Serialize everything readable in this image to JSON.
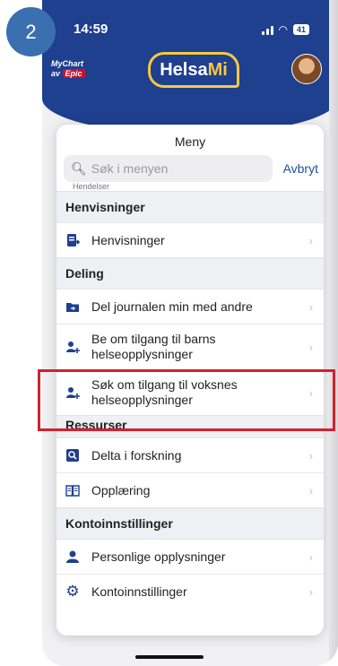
{
  "step_badge": "2",
  "status_bar": {
    "time": "14:59",
    "battery": "41"
  },
  "header": {
    "mychart_line1": "MyChart",
    "mychart_by": "av",
    "mychart_epic": "Epic",
    "brand_part1": "Helsa",
    "brand_part2": "Mi"
  },
  "menu": {
    "title": "Meny",
    "search_placeholder": "Søk i menyen",
    "cancel_label": "Avbryt",
    "peek_label": "Hendelser",
    "sections": [
      {
        "title": "Henvisninger",
        "items": [
          {
            "label": "Henvisninger",
            "icon": "referral-icon"
          }
        ]
      },
      {
        "title": "Deling",
        "items": [
          {
            "label": "Del journalen min med andre",
            "icon": "share-folder-icon"
          },
          {
            "label": "Be om tilgang til barns helseopplysninger",
            "icon": "add-person-icon"
          },
          {
            "label": "Søk om tilgang til voksnes helseopplysninger",
            "icon": "add-person-icon"
          }
        ]
      },
      {
        "title": "Ressurser",
        "items": [
          {
            "label": "Delta i forskning",
            "icon": "research-icon"
          },
          {
            "label": "Opplæring",
            "icon": "book-icon"
          }
        ]
      },
      {
        "title": "Kontoinnstillinger",
        "items": [
          {
            "label": "Personlige opplysninger",
            "icon": "person-icon"
          },
          {
            "label": "Kontoinnstillinger",
            "icon": "gear-icon"
          }
        ]
      }
    ]
  },
  "colors": {
    "header_blue": "#1f3f8f",
    "accent_yellow": "#f5c93e",
    "highlight_red": "#d0222f",
    "step_badge_blue": "#3a6fb0"
  }
}
